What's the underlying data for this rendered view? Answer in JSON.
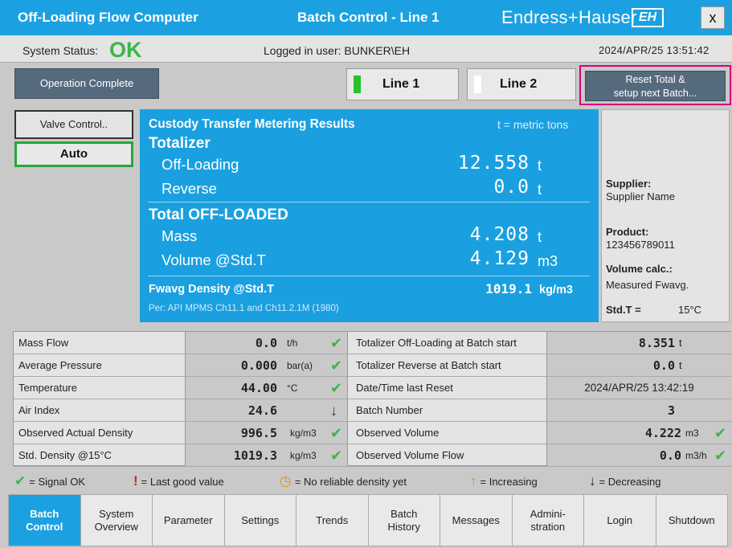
{
  "titlebar": {
    "app_title": "Off-Loading Flow Computer",
    "center_title": "Batch Control - Line 1",
    "brand": "Endress+Hauser",
    "logo_text": "EH",
    "close_label": "x"
  },
  "status": {
    "system_status_label": "System Status:",
    "system_status_value": "OK",
    "logged_in": "Logged in user: BUNKER\\EH",
    "datetime": "2024/APR/25  13:51:42"
  },
  "actions": {
    "operation_label": "Operation Complete",
    "line1_label": "Line 1",
    "line2_label": "Line 2",
    "reset_line1": "Reset Total &",
    "reset_line2": "setup next Batch..."
  },
  "valve": {
    "valve_label": "Valve Control..",
    "auto_label": "Auto"
  },
  "results": {
    "title": "Custody Transfer Metering Results",
    "unit_note": "t = metric tons",
    "totalizer_header": "Totalizer",
    "offloading_label": "Off-Loading",
    "offloading_value": "12.558",
    "offloading_unit": "t",
    "reverse_label": "Reverse",
    "reverse_value": "0.0",
    "reverse_unit": "t",
    "total_header": "Total OFF-LOADED",
    "mass_label": "Mass",
    "mass_value": "4.208",
    "mass_unit": "t",
    "volume_label": "Volume @Std.T",
    "volume_value": "4.129",
    "volume_unit": "m3",
    "density_label": "Fwavg Density @Std.T",
    "density_value": "1019.1",
    "density_unit": "kg/m3",
    "method": "Per: API MPMS Ch11.1 and Ch11.2.1M (1980)"
  },
  "info": {
    "supplier_key": "Supplier:",
    "supplier_val": "Supplier Name",
    "product_key": "Product:",
    "product_val": "123456789011",
    "volcalc_key": "Volume calc.:",
    "volcalc_val": "Measured Fwavg.",
    "stdt_key": "Std.T =",
    "stdt_val": "15°C"
  },
  "table": {
    "left": [
      {
        "label": "Mass Flow",
        "value": "0.0",
        "unit": "t/h",
        "icon": "check"
      },
      {
        "label": "Average Pressure",
        "value": "0.000",
        "unit": "bar(a)",
        "icon": "check"
      },
      {
        "label": "Temperature",
        "value": "44.00",
        "unit": "°C",
        "icon": "check"
      },
      {
        "label": "Air Index",
        "value": "24.6",
        "unit": "",
        "icon": "down"
      },
      {
        "label": "Observed Actual Density",
        "value": "996.5",
        "unit": "kg/m3",
        "icon": "check"
      },
      {
        "label": "Std. Density @15°C",
        "value": "1019.3",
        "unit": "kg/m3",
        "icon": "check"
      }
    ],
    "right": [
      {
        "label": "Totalizer Off-Loading at Batch start",
        "value": "8.351",
        "unit": "t",
        "icon": ""
      },
      {
        "label": "Totalizer Reverse at Batch start",
        "value": "0.0",
        "unit": "t",
        "icon": ""
      },
      {
        "label": "Date/Time last Reset",
        "value": "2024/APR/25 13:42:19",
        "unit": "",
        "icon": ""
      },
      {
        "label": "Batch Number",
        "value": "3",
        "unit": "",
        "icon": ""
      },
      {
        "label": "Observed Volume",
        "value": "4.222",
        "unit": "m3",
        "icon": "check"
      },
      {
        "label": "Observed Volume Flow",
        "value": "0.0",
        "unit": "m3/h",
        "icon": "check"
      }
    ]
  },
  "legend": {
    "signal_ok": "= Signal OK",
    "last_good": "= Last good value",
    "no_density": "= No reliable density yet",
    "increasing": "= Increasing",
    "decreasing": "= Decreasing"
  },
  "nav": {
    "items": [
      {
        "l1": "Batch",
        "l2": "Control"
      },
      {
        "l1": "System",
        "l2": "Overview"
      },
      {
        "l1": "Parameter",
        "l2": ""
      },
      {
        "l1": "Settings",
        "l2": ""
      },
      {
        "l1": "Trends",
        "l2": ""
      },
      {
        "l1": "Batch",
        "l2": "History"
      },
      {
        "l1": "Messages",
        "l2": ""
      },
      {
        "l1": "Admini-",
        "l2": "stration"
      },
      {
        "l1": "Login",
        "l2": ""
      },
      {
        "l1": "Shutdown",
        "l2": ""
      }
    ]
  },
  "colors": {
    "accent": "#1ba1e2",
    "ok_green": "#3db54a",
    "highlight": "#d7007a",
    "line1_indicator": "#27c22a",
    "line2_indicator": "#ffffff"
  }
}
